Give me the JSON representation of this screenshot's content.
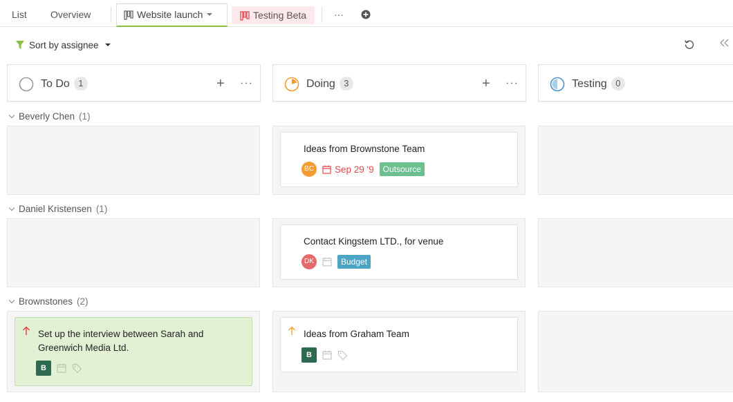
{
  "tabs": {
    "list": "List",
    "overview": "Overview",
    "website_launch": "Website launch",
    "testing_beta": "Testing Beta",
    "more": "···"
  },
  "toolbar": {
    "sort_label": "Sort by assignee"
  },
  "columns": [
    {
      "title": "To Do",
      "count": "1",
      "add": "+",
      "more": "···"
    },
    {
      "title": "Doing",
      "count": "3",
      "add": "+",
      "more": "···"
    },
    {
      "title": "Testing",
      "count": "0"
    }
  ],
  "groups": [
    {
      "name": "Beverly Chen",
      "count": "(1)"
    },
    {
      "name": "Daniel Kristensen",
      "count": "(1)"
    },
    {
      "name": "Brownstones",
      "count": "(2)"
    }
  ],
  "cards": {
    "brownstone": {
      "title": "Ideas from Brownstone Team",
      "avatar": "BC",
      "date": "Sep 29 '9",
      "tag": "Outsource"
    },
    "kingstem": {
      "title": "Contact Kingstem LTD., for venue",
      "avatar": "DK",
      "tag": "Budget"
    },
    "interview": {
      "title_line1": "Set up the interview between Sarah and",
      "title_line2": "Greenwich Media Ltd.",
      "avatar": "B"
    },
    "graham": {
      "title": "Ideas from Graham Team",
      "avatar": "B"
    }
  },
  "colors": {
    "accent_green": "#8bbf3f",
    "avatar_orange": "#f39c33",
    "avatar_red": "#e66a6a",
    "tag_outsource": "#6cbf8f",
    "tag_budget": "#4aa6c4",
    "due_red": "#e0484d",
    "priority_up_red": "#e0484d",
    "priority_up_orange": "#f0a53a"
  }
}
